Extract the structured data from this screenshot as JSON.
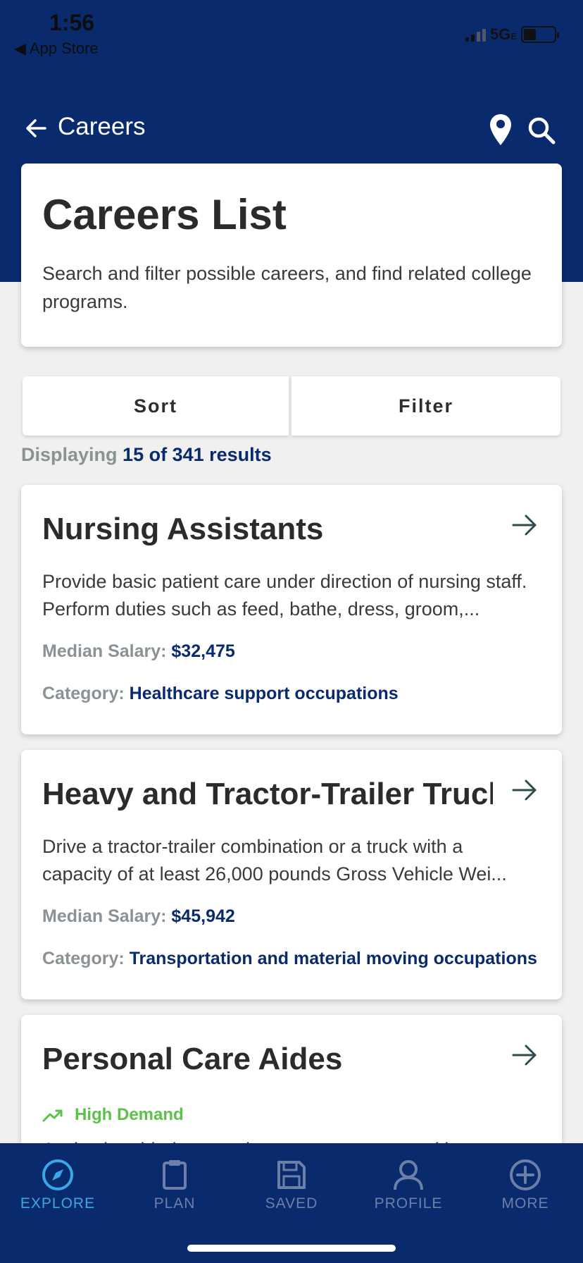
{
  "status": {
    "time": "1:56",
    "back_app": "◀ App Store",
    "network": "5G",
    "network_suffix": "E"
  },
  "nav": {
    "title": "Careers"
  },
  "intro": {
    "title": "Careers List",
    "description": "Search and filter possible careers, and find related college programs."
  },
  "controls": {
    "sort_label": "Sort",
    "filter_label": "Filter"
  },
  "results": {
    "prefix": "Displaying",
    "count_text": "15 of 341 results"
  },
  "careers": [
    {
      "title": "Nursing Assistants",
      "description": "Provide basic patient care under direction of nursing staff. Perform duties such as feed, bathe, dress, groom,...",
      "salary_label": "Median Salary:",
      "salary": "$32,475",
      "category_label": "Category:",
      "category": "Healthcare support occupations"
    },
    {
      "title": "Heavy and Tractor-Trailer Truck...",
      "description": "Drive a tractor-trailer combination or a truck with a capacity of at least 26,000 pounds Gross Vehicle Wei...",
      "salary_label": "Median Salary:",
      "salary": "$45,942",
      "category_label": "Category:",
      "category": "Transportation and material moving occupations"
    },
    {
      "title": "Personal Care Aides",
      "badge": "High Demand",
      "description": "Assist the elderly, convalescents, or persons with"
    }
  ],
  "tabs": [
    {
      "label": "EXPLORE",
      "icon": "compass-icon",
      "active": true
    },
    {
      "label": "PLAN",
      "icon": "clipboard-icon",
      "active": false
    },
    {
      "label": "SAVED",
      "icon": "floppy-disk-icon",
      "active": false
    },
    {
      "label": "PROFILE",
      "icon": "person-icon",
      "active": false
    },
    {
      "label": "MORE",
      "icon": "plus-circle-icon",
      "active": false
    }
  ],
  "colors": {
    "brand_navy": "#0a2a6e",
    "accent_blue": "#3aa8e6",
    "demand_green": "#5cc24a",
    "muted_gray": "#8a9296"
  }
}
